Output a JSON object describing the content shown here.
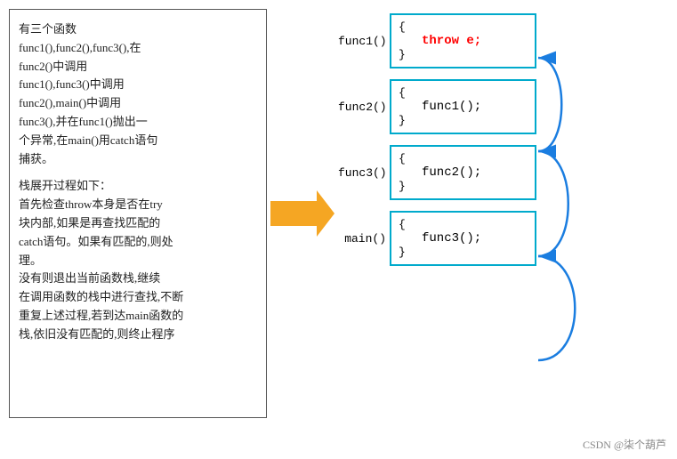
{
  "left": {
    "intro": "有三个函数",
    "line1": "func1(),func2(),func3(),在",
    "line2": "func2()中调用",
    "line3": "func1(),func3()中调用",
    "line4": "func2(),main()中调用",
    "line5": "func3(),并在func1()抛出一",
    "line6": "个异常,在main()用catch语句",
    "line7": "捕获。",
    "blank": "",
    "stack_title": "栈展开过程如下：",
    "stack1": "    首先检查throw本身是否在try",
    "stack2": "块内部,如果是再查找匹配的",
    "stack3": "catch语句。如果有匹配的,则处",
    "stack4": "理。",
    "stack5": "    没有则退出当前函数栈,继续",
    "stack6": "在调用函数的栈中进行查找,不断",
    "stack7": "重复上述过程,若到达main函数的",
    "stack8": "栈,依旧没有匹配的,则终止程序"
  },
  "funcs": [
    {
      "label": "func1()",
      "content": "throw e;",
      "is_throw": true
    },
    {
      "label": "func2()",
      "content": "func1();",
      "is_throw": false
    },
    {
      "label": "func3()",
      "content": "func2();",
      "is_throw": false
    },
    {
      "label": "main()",
      "content": "func3();",
      "is_throw": false
    }
  ],
  "watermark": "CSDN @柒个葫芦",
  "arrow_color": "#f5a623"
}
